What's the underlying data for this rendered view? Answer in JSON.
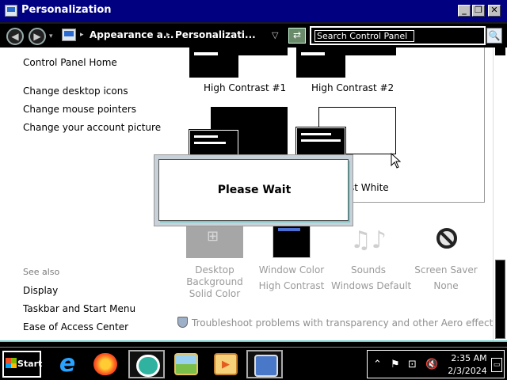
{
  "window": {
    "title": "Personalization",
    "minimize_label": "_",
    "maximize_label": "❐",
    "close_label": "✕"
  },
  "address_bar": {
    "back_label": "◀",
    "forward_label": "▶",
    "history_dropdown": "▾",
    "crumb_sep": "▸",
    "crumbs": [
      "Appearance a...",
      "Personalizati..."
    ],
    "crumbs_dropdown": "▽",
    "refresh_label": "⇄",
    "search_placeholder": "Search Control Panel",
    "search_button": "🔍"
  },
  "sidebar": {
    "links": [
      "Control Panel Home",
      "Change desktop icons",
      "Change mouse pointers",
      "Change your account picture"
    ],
    "see_also_heading": "See also",
    "see_also": [
      "Display",
      "Taskbar and Start Menu",
      "Ease of Access Center"
    ]
  },
  "themes": {
    "items": [
      {
        "label": "High Contrast #1"
      },
      {
        "label": "High Contrast #2"
      },
      {
        "label": "st White"
      }
    ]
  },
  "bottom": {
    "items": [
      {
        "label": "Desktop",
        "label2": "Background",
        "sub": "Solid Color"
      },
      {
        "label": "Window Color",
        "sub": "High Contrast"
      },
      {
        "label": "Sounds",
        "sub": "Windows Default"
      },
      {
        "label": "Screen Saver",
        "sub": "None"
      }
    ],
    "sound_icon": "♫♪",
    "troubleshoot": "Troubleshoot problems with transparency and other Aero effects"
  },
  "dialog": {
    "text": "Please Wait"
  },
  "taskbar": {
    "start_label": "Start",
    "ie_glyph": "e",
    "tray": {
      "chevron": "⌃",
      "flag": "⚑",
      "network": "⊡",
      "volume": "🔇",
      "time": "2:35 AM",
      "date": "2/3/2024",
      "show_desktop": "▭"
    }
  },
  "colors": {
    "titlebar": "#000080",
    "accent_border": "#6ccfcf",
    "disabled_text": "#9a9a9a"
  }
}
